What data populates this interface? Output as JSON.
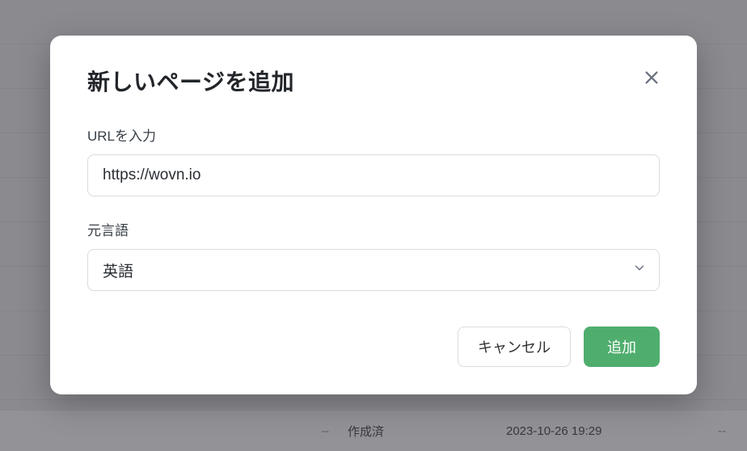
{
  "modal": {
    "title": "新しいページを追加",
    "url_label": "URLを入力",
    "url_value": "https://wovn.io",
    "lang_label": "元言語",
    "lang_selected": "英語",
    "cancel_label": "キャンセル",
    "submit_label": "追加"
  },
  "background": {
    "status_text": "作成済",
    "date_text": "2023-10-26 19:29",
    "dash": "--",
    "hyphen": "–"
  }
}
